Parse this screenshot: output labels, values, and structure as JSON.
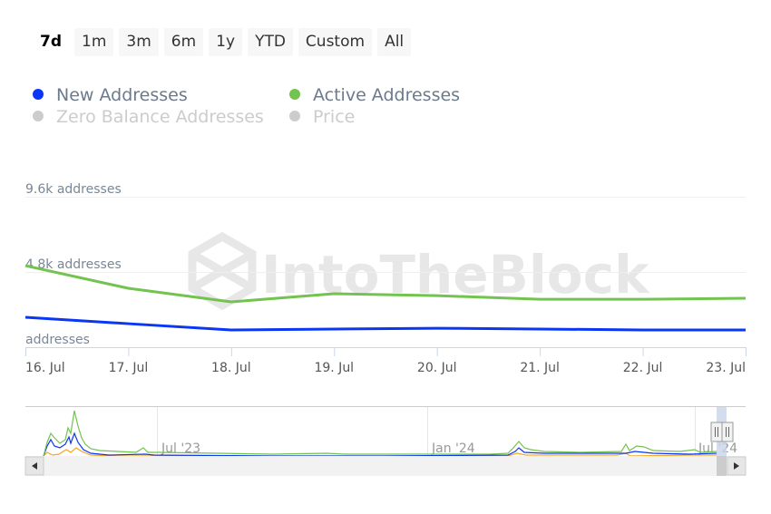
{
  "range_selector": {
    "buttons": [
      {
        "label": "7d",
        "active": true
      },
      {
        "label": "1m",
        "active": false
      },
      {
        "label": "3m",
        "active": false
      },
      {
        "label": "6m",
        "active": false
      },
      {
        "label": "1y",
        "active": false
      },
      {
        "label": "YTD",
        "active": false
      },
      {
        "label": "Custom",
        "active": false
      },
      {
        "label": "All",
        "active": false
      }
    ]
  },
  "legend": {
    "items": [
      {
        "label": "New Addresses",
        "color": "#0a36f5",
        "visible": true
      },
      {
        "label": "Active Addresses",
        "color": "#72c34f",
        "visible": true
      },
      {
        "label": "Zero Balance Addresses",
        "color": "#cccccc",
        "visible": false
      },
      {
        "label": "Price",
        "color": "#cccccc",
        "visible": false
      }
    ]
  },
  "watermark": "IntoTheBlock",
  "chart_data": {
    "type": "line",
    "title": "",
    "xlabel": "",
    "ylabel": "addresses",
    "categories": [
      "16. Jul",
      "17. Jul",
      "18. Jul",
      "19. Jul",
      "20. Jul",
      "21. Jul",
      "22. Jul",
      "23. Jul"
    ],
    "y_ticks": [
      {
        "value": 0,
        "label": "addresses"
      },
      {
        "value": 4800,
        "label": "4.8k addresses"
      },
      {
        "value": 9600,
        "label": "9.6k addresses"
      }
    ],
    "ylim": [
      0,
      9600
    ],
    "grid": true,
    "series": [
      {
        "name": "Active Addresses",
        "color": "#72c34f",
        "values": [
          5200,
          3760,
          2890,
          3410,
          3290,
          3060,
          3060,
          3120
        ]
      },
      {
        "name": "New Addresses",
        "color": "#0a36f5",
        "values": [
          1910,
          1500,
          1100,
          1160,
          1210,
          1160,
          1100,
          1100
        ]
      }
    ],
    "navigator": {
      "labels": [
        "Jul '23",
        "Jan '24",
        "Jul '24"
      ],
      "series_colors": {
        "active": "#72c34f",
        "new": "#0a36f5",
        "zero": "#f5a623"
      },
      "selected_range": "last 7 days"
    }
  }
}
